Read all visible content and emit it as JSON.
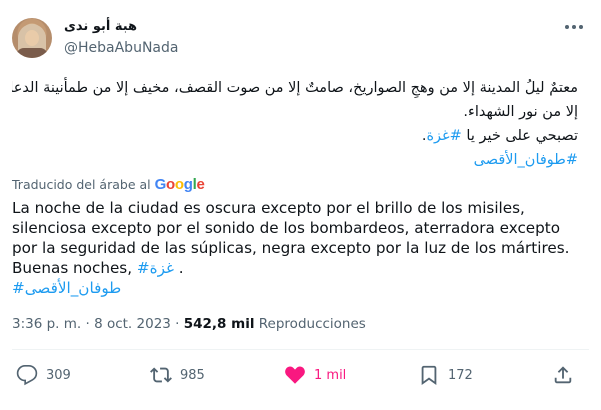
{
  "author": {
    "name": "هبة أبو ندى",
    "handle": "@HebaAbuNada"
  },
  "tweet": {
    "arabic_lines": [
      "معتمٌ ليلُ المدينة إلا من وهجِ الصواريخ، صامتٌ إلا من صوت القصف، مخيف إلا من طمأنينة الدعاء، أسود",
      "إلا من نور الشهداء.",
      "تصبحي على خير يا "
    ],
    "arabic_hashtag_gaza": "#غزة",
    "arabic_line3_end": ".",
    "arabic_hashtag_flood": "#طوفان_الأقصى",
    "translated_label": "Traducido del árabe al",
    "google_logo": {
      "G": "G",
      "o1": "o",
      "o2": "o",
      "g": "g",
      "l": "l",
      "e": "e"
    },
    "spanish_lines": [
      "La noche de la ciudad es oscura excepto por el brillo de los misiles,",
      "silenciosa excepto por el sonido de los bombardeos, aterradora excepto",
      "por la seguridad de las súplicas, negra excepto por la luz de los mártires."
    ],
    "spanish_line4_start": "Buenas noches, ",
    "spanish_hashtag_gaza": "#غزة",
    "spanish_line4_end": " .",
    "spanish_hashtag_flood": "#طوفان_الأقصى"
  },
  "meta": {
    "time": "3:36 p. m.",
    "sep1": " · ",
    "date": "8 oct. 2023",
    "sep2": " · ",
    "views": "542,8 mil",
    "views_label": " Reproducciones"
  },
  "actions": {
    "reply_count": "309",
    "retweet_count": "985",
    "like_count": "1 mil",
    "bookmark_count": "172"
  },
  "colors": {
    "link": "#1d9bf0",
    "like": "#f91880",
    "muted": "#536471",
    "text": "#0f1419"
  },
  "icons": [
    "more-icon",
    "reply-icon",
    "retweet-icon",
    "like-icon",
    "bookmark-icon",
    "share-icon"
  ]
}
